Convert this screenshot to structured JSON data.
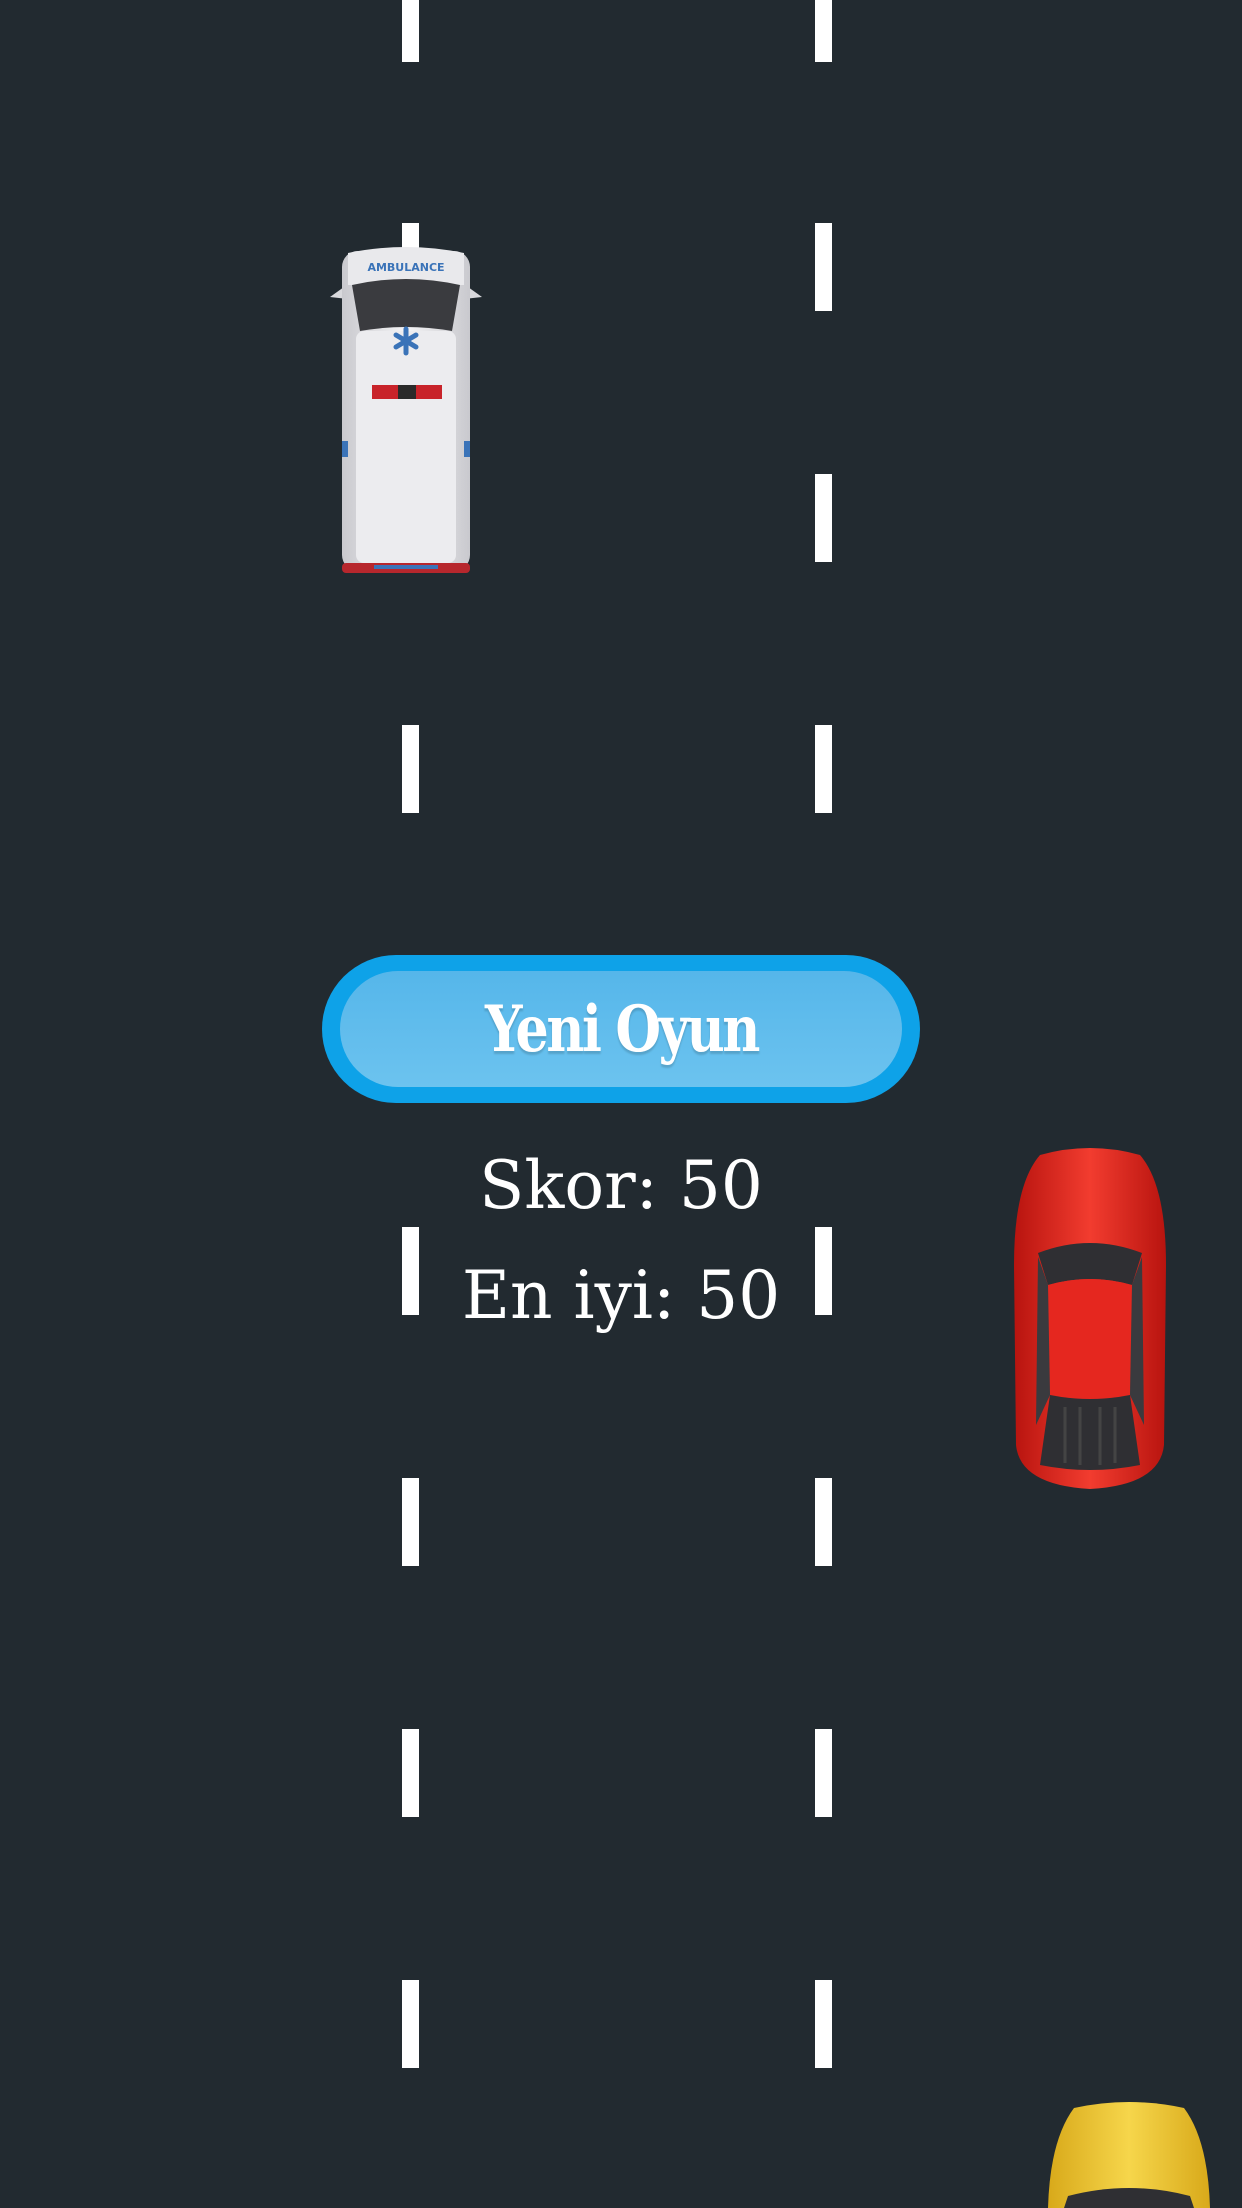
{
  "game": {
    "menu": {
      "new_game_label": "Yeni Oyun"
    },
    "score": {
      "current_text": "Skor: 50",
      "best_text": "En iyi: 50"
    },
    "vehicles": [
      {
        "type": "ambulance",
        "label": "AMBULANCE",
        "color": "#f0f0f2"
      },
      {
        "type": "car",
        "color": "#e8231c"
      },
      {
        "type": "car",
        "color": "#f2cf2a"
      }
    ]
  },
  "colors": {
    "road": "#222a30",
    "lane_marking": "#ffffff",
    "button_border": "#0ea2e8",
    "button_fill": "#5fbdec"
  }
}
